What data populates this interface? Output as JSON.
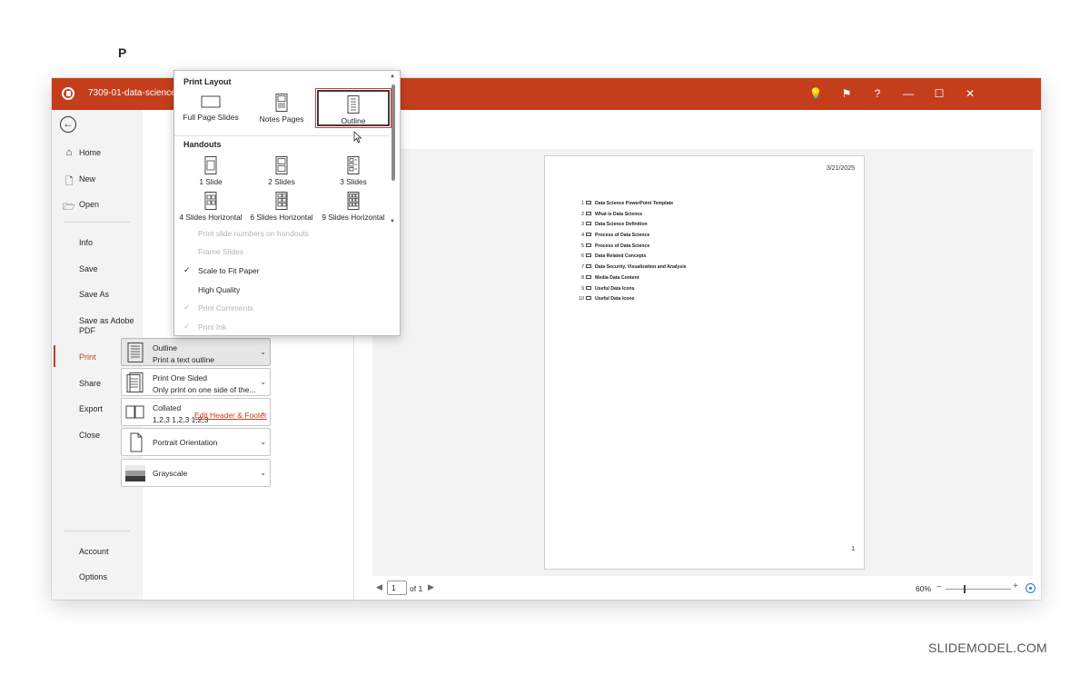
{
  "window": {
    "doc_title": "7309-01-data-science-p",
    "colors": {
      "accent": "#c43e1c",
      "sidebar_bg": "#f3f3f3"
    }
  },
  "titlebar_buttons": [
    {
      "name": "lightbulb-icon",
      "glyph": "💡"
    },
    {
      "name": "coauthor-icon",
      "glyph": "⚑"
    },
    {
      "name": "help-icon",
      "glyph": "?"
    },
    {
      "name": "minimize-icon",
      "glyph": "—"
    },
    {
      "name": "maximize-icon",
      "glyph": "☐"
    },
    {
      "name": "close-icon",
      "glyph": "✕"
    }
  ],
  "sidebar": {
    "back_glyph": "←",
    "items": [
      {
        "label": "Home",
        "glyph": "⌂"
      },
      {
        "label": "New",
        "glyph": "🗋"
      },
      {
        "label": "Open",
        "glyph": "🗁"
      },
      {
        "label": "Info"
      },
      {
        "label": "Save"
      },
      {
        "label": "Save As"
      },
      {
        "label": "Save as Adobe PDF"
      },
      {
        "label": "Print",
        "active": true
      },
      {
        "label": "Share"
      },
      {
        "label": "Export"
      },
      {
        "label": "Close"
      },
      {
        "label": "Account"
      },
      {
        "label": "Options"
      }
    ]
  },
  "print_pane": {
    "heading_stub": "P",
    "options": [
      {
        "title": "Outline",
        "subtitle": "Print a text outline",
        "icon": "outline-page-icon",
        "selected": true
      },
      {
        "title": "Print One Sided",
        "subtitle": "Only print on one side of the...",
        "icon": "one-sided-icon"
      },
      {
        "title": "Collated",
        "subtitle": "1,2,3    1,2,3    1,2,3",
        "icon": "collated-icon"
      },
      {
        "title": "Portrait Orientation",
        "subtitle": "",
        "icon": "portrait-icon"
      },
      {
        "title": "Grayscale",
        "subtitle": "",
        "icon": "grayscale-icon"
      }
    ],
    "edit_header_footer": "Edit Header & Footer"
  },
  "dropdown": {
    "print_layout_heading": "Print Layout",
    "layout_tiles": [
      {
        "label": "Full Page Slides",
        "icon": "full-page-slides-icon"
      },
      {
        "label": "Notes Pages",
        "icon": "notes-pages-icon"
      },
      {
        "label": "Outline",
        "icon": "outline-icon",
        "selected": true
      }
    ],
    "handouts_heading": "Handouts",
    "handout_tiles": [
      {
        "label": "1 Slide",
        "icon": "handout-1-slide-icon"
      },
      {
        "label": "2 Slides",
        "icon": "handout-2-slides-icon"
      },
      {
        "label": "3 Slides",
        "icon": "handout-3-slides-icon"
      },
      {
        "label": "4 Slides Horizontal",
        "icon": "handout-4-slides-icon"
      },
      {
        "label": "6 Slides Horizontal",
        "icon": "handout-6-slides-icon"
      },
      {
        "label": "9 Slides Horizontal",
        "icon": "handout-9-slides-icon"
      }
    ],
    "checks": [
      {
        "label": "Print slide numbers on handouts",
        "checked": false,
        "disabled": true
      },
      {
        "label": "Frame Slides",
        "checked": false,
        "disabled": true
      },
      {
        "label": "Scale to Fit Paper",
        "checked": true,
        "disabled": false
      },
      {
        "label": "High Quality",
        "checked": false,
        "disabled": false
      },
      {
        "label": "Print Comments",
        "checked": true,
        "disabled": true
      },
      {
        "label": "Print Ink",
        "checked": true,
        "disabled": true
      }
    ],
    "check_glyph": "✓"
  },
  "preview": {
    "date": "3/21/2025",
    "page_number": "1",
    "outline": [
      {
        "num": "1",
        "text": "Data Science PowerPoint Template"
      },
      {
        "num": "2",
        "text": "What is Data Science"
      },
      {
        "num": "3",
        "text": "Data Science Definition"
      },
      {
        "num": "4",
        "text": "Process of Data Science"
      },
      {
        "num": "5",
        "text": "Process of Data Science"
      },
      {
        "num": "6",
        "text": "Data Related Concepts"
      },
      {
        "num": "7",
        "text": "Data Security, Visualization and Analysis"
      },
      {
        "num": "8",
        "text": "Media Data Content"
      },
      {
        "num": "9",
        "text": "Useful Data Icons"
      },
      {
        "num": "10",
        "text": "Useful Data Icons"
      }
    ]
  },
  "bottombar": {
    "prev_glyph": "◀",
    "next_glyph": "▶",
    "current_page": "1",
    "of_text": "of 1",
    "zoom": "60%",
    "minus": "−",
    "plus": "+"
  },
  "watermark": "SLIDEMODEL.COM"
}
